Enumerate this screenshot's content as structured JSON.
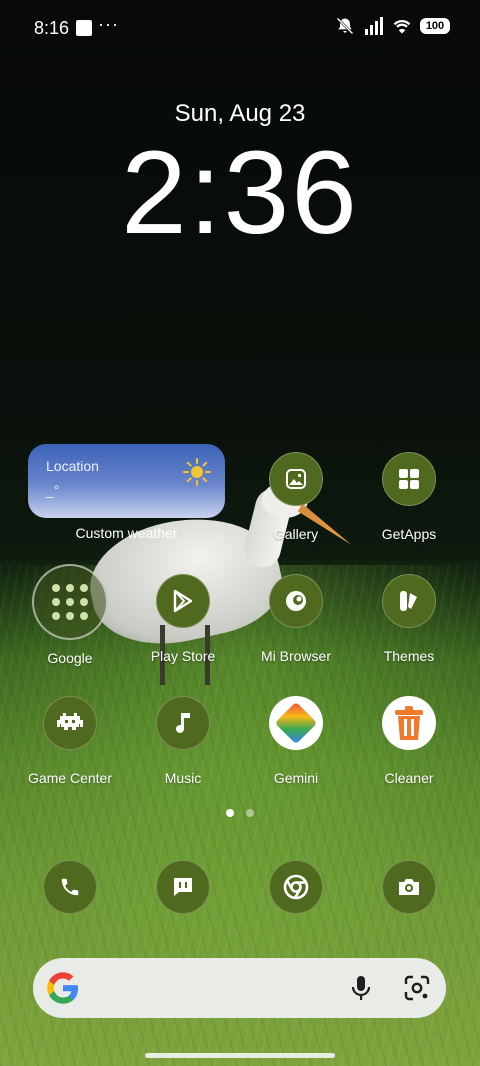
{
  "status_bar": {
    "time": "8:16",
    "battery": "100"
  },
  "lockscreen": {
    "date": "Sun, Aug 23",
    "time": "2:36"
  },
  "weather_widget": {
    "location": "Location",
    "temperature": "_°",
    "label": "Custom weather"
  },
  "apps": [
    {
      "name": "gallery",
      "label": "Gallery",
      "icon": "gallery-icon"
    },
    {
      "name": "getapps",
      "label": "GetApps",
      "icon": "grid-icon"
    },
    {
      "name": "google",
      "label": "Google",
      "icon": "folder-icon"
    },
    {
      "name": "play-store",
      "label": "Play Store",
      "icon": "play-icon"
    },
    {
      "name": "mi-browser",
      "label": "Mi Browser",
      "icon": "browser-icon"
    },
    {
      "name": "themes",
      "label": "Themes",
      "icon": "brush-icon"
    },
    {
      "name": "game-center",
      "label": "Game Center",
      "icon": "invader-icon"
    },
    {
      "name": "music",
      "label": "Music",
      "icon": "note-icon"
    },
    {
      "name": "gemini",
      "label": "Gemini",
      "icon": "gemini-icon"
    },
    {
      "name": "cleaner",
      "label": "Cleaner",
      "icon": "trash-icon"
    }
  ],
  "dock": [
    {
      "name": "phone",
      "icon": "phone-icon"
    },
    {
      "name": "messages",
      "icon": "message-icon"
    },
    {
      "name": "chrome",
      "icon": "chrome-icon"
    },
    {
      "name": "camera",
      "icon": "camera-icon"
    }
  ],
  "pages": {
    "count": 2,
    "active": 1
  },
  "colors": {
    "icon_bg": "#4f6a1e",
    "search_bg": "#e9ece6",
    "weather_top": "#3b63b7"
  }
}
